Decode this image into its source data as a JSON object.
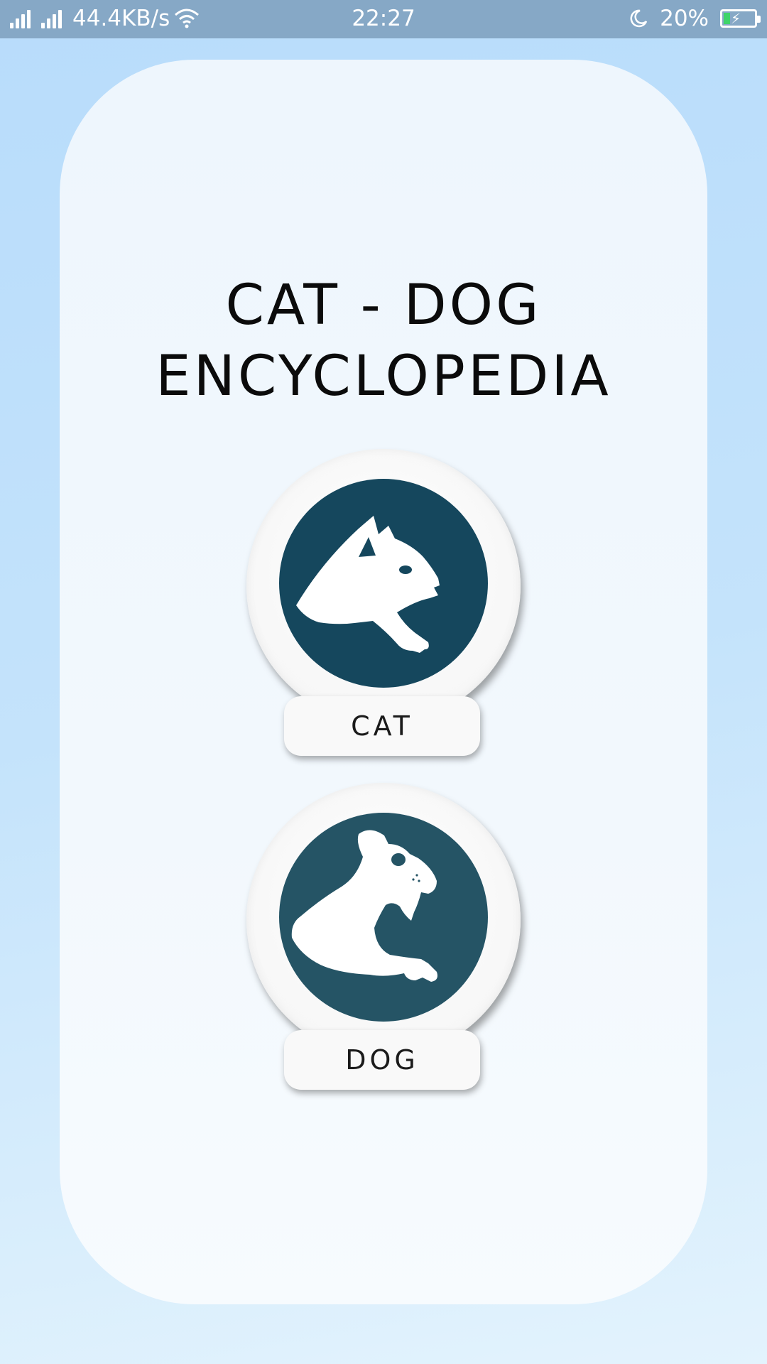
{
  "status_bar": {
    "network_speed": "44.4KB/s",
    "time": "22:27",
    "battery_percent": "20%",
    "icons": [
      "signal-icon",
      "signal-icon",
      "wifi-icon",
      "moon-icon",
      "battery-charging-icon"
    ],
    "battery_level": 0.2,
    "battery_fill_color": "#3fd46a"
  },
  "main": {
    "title_line1": "CAT - DOG",
    "title_line2": "ENCYCLOPEDIA",
    "buttons": [
      {
        "label": "CAT",
        "icon": "cat-silhouette-icon",
        "disc_color": "#15475d"
      },
      {
        "label": "DOG",
        "icon": "dog-silhouette-icon",
        "disc_color": "#255465"
      }
    ]
  }
}
